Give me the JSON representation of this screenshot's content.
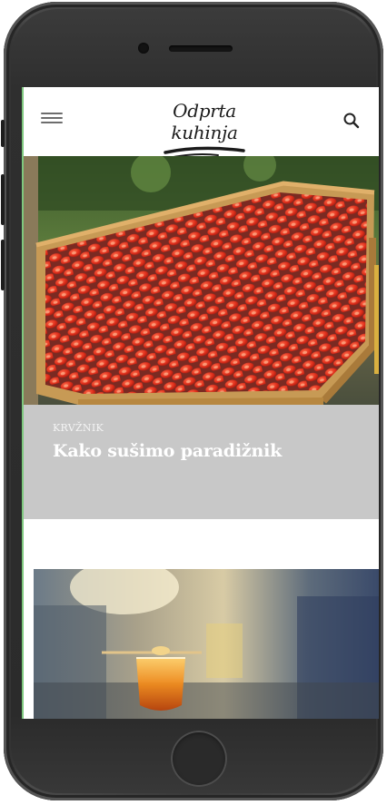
{
  "header": {
    "logo_text": "Odprta kuhinja"
  },
  "featured": {
    "category": "KRVŽNIK",
    "title": "Kako sušimo paradižnik"
  },
  "icons": {
    "menu": "hamburger-menu-icon",
    "search": "search-icon"
  },
  "colors": {
    "card_background": "#c8c8c8",
    "phone_body": "#2f2f2f",
    "screen_background": "#ffffff"
  }
}
